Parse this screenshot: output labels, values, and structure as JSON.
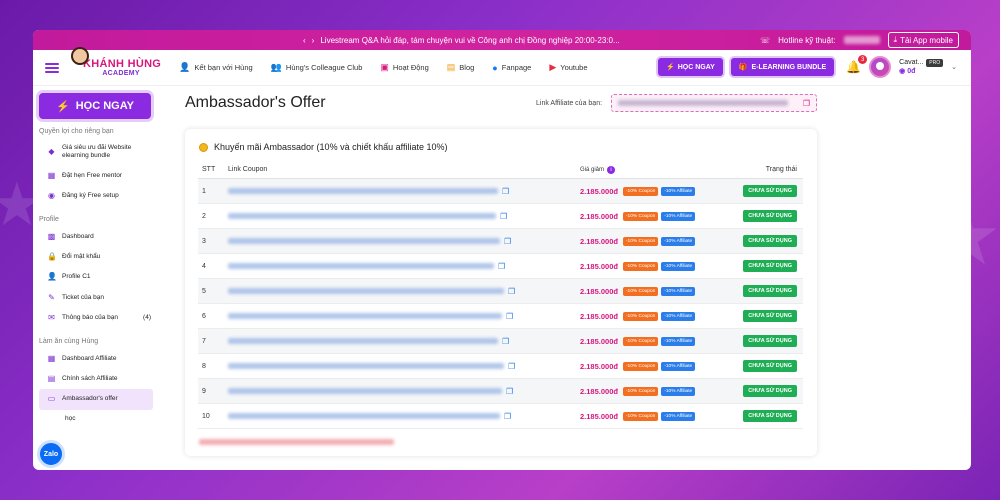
{
  "banner": {
    "announcement": "Livestream Q&A hỏi đáp, tám chuyện vui về Công anh chị Đồng nghiệp 20:00-23:0...",
    "hotline_label": "Hotline kỹ thuật:",
    "app_button": "Tải App mobile"
  },
  "nav": {
    "logo_main": "KHÁNH HÙNG",
    "logo_sub": "ACADEMY",
    "links": [
      {
        "icon": "user-add-icon",
        "label": "Kết bạn với Hùng"
      },
      {
        "icon": "users-icon",
        "label": "Hùng's Colleague Club"
      },
      {
        "icon": "activity-icon",
        "label": "Hoạt Động"
      },
      {
        "icon": "blog-icon",
        "label": "Blog"
      },
      {
        "icon": "facebook-icon",
        "label": "Fanpage"
      },
      {
        "icon": "youtube-icon",
        "label": "Youtube"
      }
    ],
    "hoc_ngay": "HỌC NGAY",
    "bundle": "E-LEARNING BUNDLE",
    "notification_count": "3",
    "user_name": "Cavat...",
    "user_badge": "PRO",
    "user_coins": "0đ"
  },
  "sidebar": {
    "hoc_ngay": "HỌC NGAY",
    "sections": [
      {
        "title": "Quyền lợi cho riêng bạn",
        "items": [
          {
            "icon": "cube-icon",
            "label": "Giá siêu ưu đãi Website elearning bundle",
            "count": ""
          },
          {
            "icon": "calendar-icon",
            "label": "Đặt hẹn Free mentor",
            "count": ""
          },
          {
            "icon": "setup-icon",
            "label": "Đăng ký Free setup",
            "count": ""
          }
        ]
      },
      {
        "title": "Profile",
        "items": [
          {
            "icon": "dashboard-icon",
            "label": "Dashboard",
            "count": ""
          },
          {
            "icon": "lock-icon",
            "label": "Đổi mật khẩu",
            "count": ""
          },
          {
            "icon": "person-icon",
            "label": "Profile C1",
            "count": ""
          },
          {
            "icon": "ticket-icon",
            "label": "Ticket của bạn",
            "count": ""
          },
          {
            "icon": "mail-icon",
            "label": "Thông báo của bạn",
            "count": "(4)"
          }
        ]
      },
      {
        "title": "Làm ăn cùng Hùng",
        "items": [
          {
            "icon": "chart-icon",
            "label": "Dashboard Affiliate",
            "count": ""
          },
          {
            "icon": "document-icon",
            "label": "Chính sách Affiliate",
            "count": ""
          },
          {
            "icon": "offer-icon",
            "label": "Ambassador's offer",
            "count": "",
            "active": true
          }
        ]
      }
    ],
    "trailing_label": "học",
    "zalo": "Zalo"
  },
  "main": {
    "title": "Ambassador's Offer",
    "affiliate_label": "Link Affiliate của bạn:",
    "card_title": "Khuyến mãi Ambassador (10% và chiết khấu affiliate 10%)",
    "columns": {
      "stt": "STT",
      "link": "Link Coupon",
      "price": "Giá giảm",
      "status": "Trạng thái"
    },
    "rows": [
      {
        "stt": "1",
        "price": "2.185.000đ",
        "coupon": "-10% Coupon",
        "affiliate": "-10% Affiliate",
        "status": "CHƯA SỬ DỤNG"
      },
      {
        "stt": "2",
        "price": "2.185.000đ",
        "coupon": "-10% Coupon",
        "affiliate": "-10% Affiliate",
        "status": "CHƯA SỬ DỤNG"
      },
      {
        "stt": "3",
        "price": "2.185.000đ",
        "coupon": "-10% Coupon",
        "affiliate": "-10% Affiliate",
        "status": "CHƯA SỬ DỤNG"
      },
      {
        "stt": "4",
        "price": "2.185.000đ",
        "coupon": "-10% Coupon",
        "affiliate": "-10% Affiliate",
        "status": "CHƯA SỬ DỤNG"
      },
      {
        "stt": "5",
        "price": "2.185.000đ",
        "coupon": "-10% Coupon",
        "affiliate": "-10% Affiliate",
        "status": "CHƯA SỬ DỤNG"
      },
      {
        "stt": "6",
        "price": "2.185.000đ",
        "coupon": "-10% Coupon",
        "affiliate": "-10% Affiliate",
        "status": "CHƯA SỬ DỤNG"
      },
      {
        "stt": "7",
        "price": "2.185.000đ",
        "coupon": "-10% Coupon",
        "affiliate": "-10% Affiliate",
        "status": "CHƯA SỬ DỤNG"
      },
      {
        "stt": "8",
        "price": "2.185.000đ",
        "coupon": "-10% Coupon",
        "affiliate": "-10% Affiliate",
        "status": "CHƯA SỬ DỤNG"
      },
      {
        "stt": "9",
        "price": "2.185.000đ",
        "coupon": "-10% Coupon",
        "affiliate": "-10% Affiliate",
        "status": "CHƯA SỬ DỤNG"
      },
      {
        "stt": "10",
        "price": "2.185.000đ",
        "coupon": "-10% Coupon",
        "affiliate": "-10% Affiliate",
        "status": "CHƯA SỬ DỤNG"
      }
    ]
  },
  "colors": {
    "brand_purple": "#8a2be2",
    "brand_pink": "#d7167f",
    "status_green": "#1fae55",
    "coupon_orange": "#f26f21",
    "affiliate_blue": "#2b7de9"
  }
}
